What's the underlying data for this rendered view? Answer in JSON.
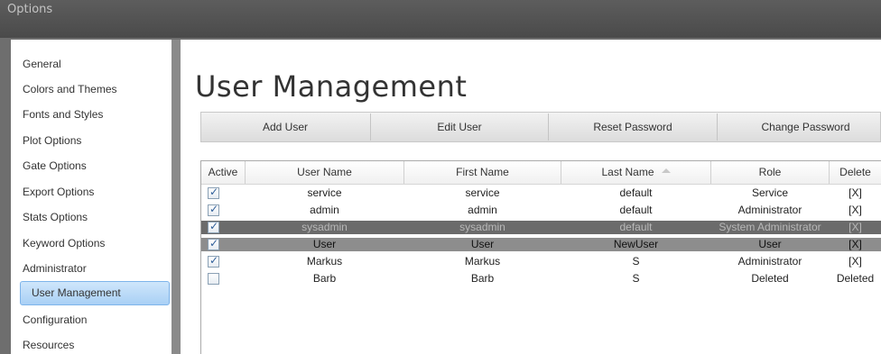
{
  "window": {
    "title": "Options"
  },
  "sidebar": {
    "items": [
      {
        "label": "General"
      },
      {
        "label": "Colors and Themes"
      },
      {
        "label": "Fonts and Styles"
      },
      {
        "label": "Plot Options"
      },
      {
        "label": "Gate Options"
      },
      {
        "label": "Export Options"
      },
      {
        "label": "Stats Options"
      },
      {
        "label": "Keyword Options"
      },
      {
        "label": "Administrator"
      },
      {
        "label": "User Management",
        "selected": true
      },
      {
        "label": "Configuration"
      },
      {
        "label": "Resources"
      }
    ]
  },
  "main": {
    "title": "User Management",
    "toolbar": {
      "add_user": "Add User",
      "edit_user": "Edit User",
      "reset_password": "Reset Password",
      "change_password": "Change Password"
    },
    "table": {
      "headers": {
        "active": "Active",
        "user_name": "User Name",
        "first_name": "First Name",
        "last_name": "Last Name",
        "role": "Role",
        "delete": "Delete"
      },
      "sorted_column": "Last Name",
      "rows": [
        {
          "active": true,
          "user_name": "service",
          "first_name": "service",
          "last_name": "default",
          "role": "Service",
          "delete": "[X]"
        },
        {
          "active": true,
          "user_name": "admin",
          "first_name": "admin",
          "last_name": "default",
          "role": "Administrator",
          "delete": "[X]"
        },
        {
          "active": true,
          "user_name": "sysadmin",
          "first_name": "sysadmin",
          "last_name": "default",
          "role": "System Administrator",
          "delete": "[X]"
        },
        {
          "active": true,
          "user_name": "User",
          "first_name": "User",
          "last_name": "NewUser",
          "role": "User",
          "delete": "[X]"
        },
        {
          "active": true,
          "user_name": "Markus",
          "first_name": "Markus",
          "last_name": "S",
          "role": "Administrator",
          "delete": "[X]"
        },
        {
          "active": false,
          "user_name": "Barb",
          "first_name": "Barb",
          "last_name": "S",
          "role": "Deleted",
          "delete": "Deleted"
        }
      ]
    }
  },
  "colors": {
    "selected_nav": "#a9d0f5",
    "row_dark": "#6b6b6b",
    "row_mid": "#8d8d8d",
    "checkbox_tick": "#2f5f9a"
  }
}
